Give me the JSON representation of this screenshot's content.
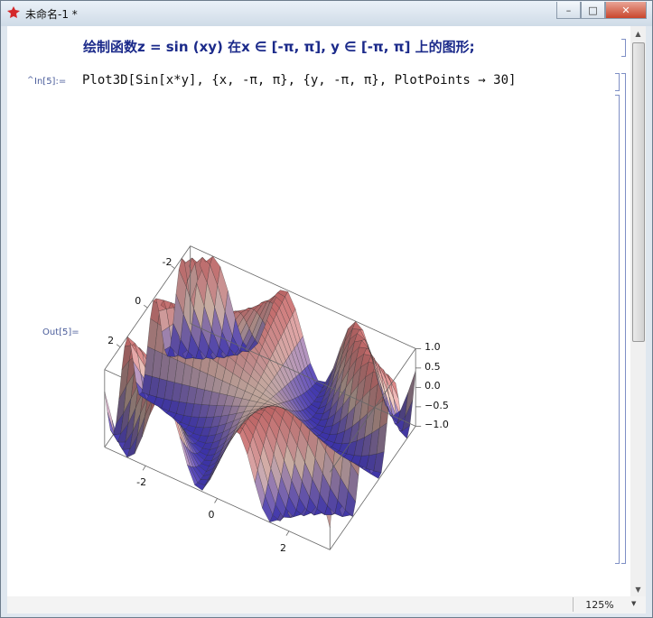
{
  "window": {
    "title": "未命名-1 *",
    "controls": {
      "minimize": "–",
      "maximize": "□",
      "close": "✕"
    }
  },
  "notebook": {
    "caption": "绘制函数z = sin (xy) 在x ∈ [-π, π], y ∈ [-π, π] 上的图形;",
    "input_label": "In[5]:=",
    "input_caret": "^",
    "input_code": "Plot3D[Sin[x*y], {x, -π, π}, {y, -π, π}, PlotPoints → 30]",
    "output_label": "Out[5]="
  },
  "status": {
    "zoom": "125%",
    "zoom_arrow": "▼"
  },
  "chart_data": {
    "type": "surface3d",
    "function": "Sin[x*y]",
    "x_range": [
      -3.14159,
      3.14159
    ],
    "y_range": [
      -3.14159,
      3.14159
    ],
    "z_range": [
      -1,
      1
    ],
    "plot_points": 30,
    "x_ticks": [
      "-2",
      "0",
      "2"
    ],
    "y_ticks": [
      "2",
      "0",
      "-2"
    ],
    "z_ticks": [
      "1.0",
      "0.5",
      "0.0",
      "−0.5",
      "−1.0"
    ],
    "colors": {
      "low": "#4a3fd8",
      "mid": "#f0c6c6",
      "high": "#ef7f7f",
      "accent": "#fff3c6"
    }
  }
}
